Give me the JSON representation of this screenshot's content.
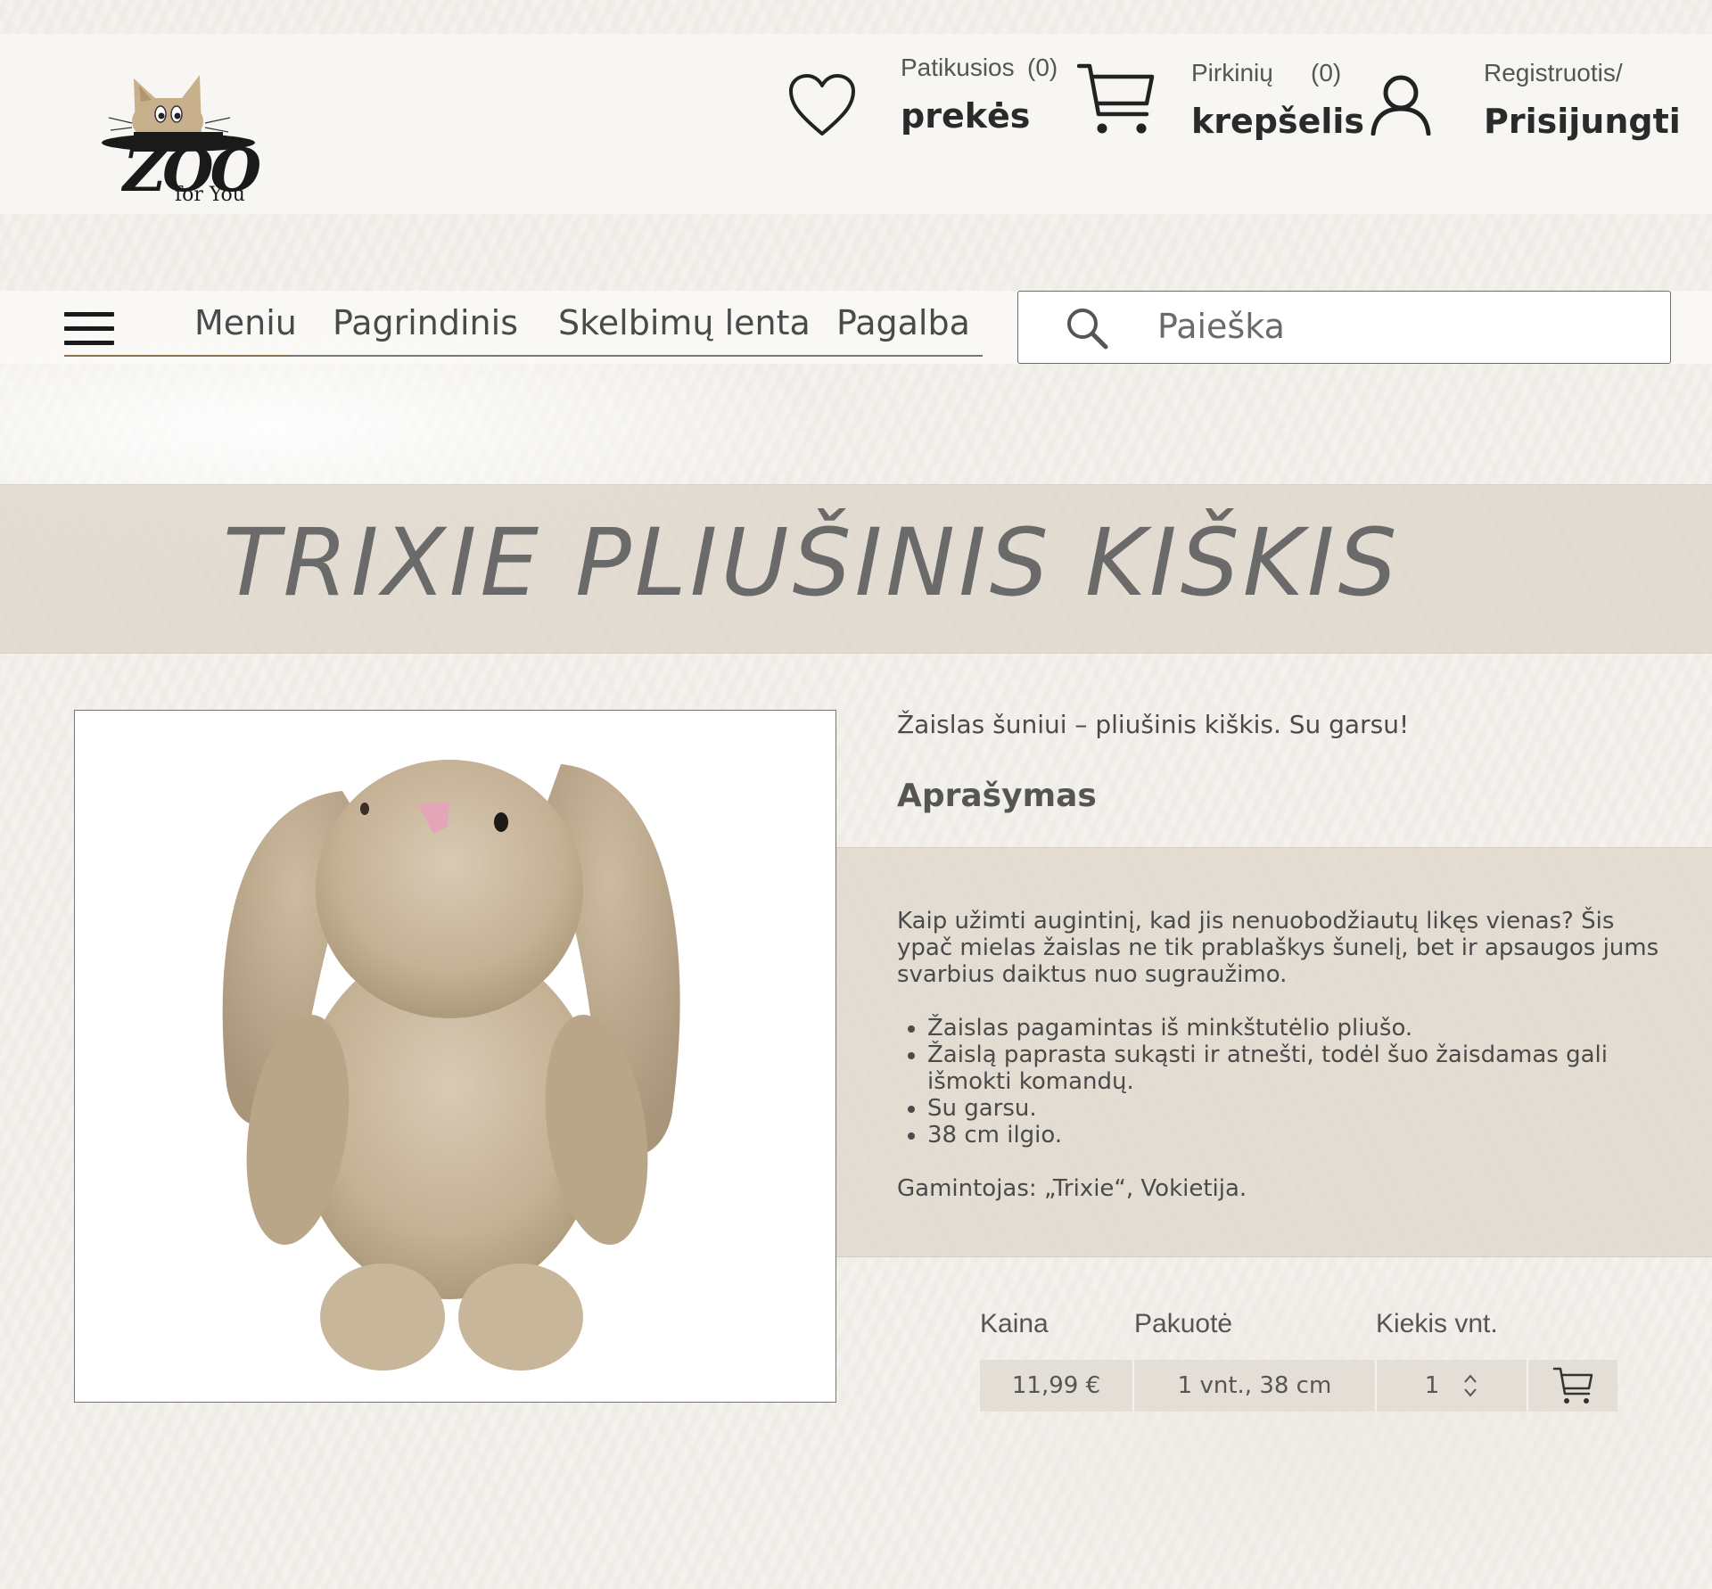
{
  "header": {
    "logo": {
      "alt": "Zoo for You",
      "main": "ZOO",
      "sub": "for You"
    },
    "wishlist": {
      "line1": "Patikusios",
      "count": "(0)",
      "line2": "prekės",
      "icon": "heart-icon"
    },
    "cart": {
      "line1": "Pirkinių",
      "count": "(0)",
      "line2": "krepšelis",
      "icon": "cart-icon"
    },
    "account": {
      "line1": "Registruotis/",
      "line2": "Prisijungti",
      "icon": "user-icon"
    }
  },
  "nav": {
    "menu_icon": "hamburger-icon",
    "items": [
      "Meniu",
      "Pagrindinis",
      "Skelbimų lenta",
      "Pagalba"
    ]
  },
  "search": {
    "placeholder": "Paieška",
    "icon": "search-icon"
  },
  "product": {
    "title": "TRIXIE PLIUŠINIS KIŠKIS",
    "short_description": "Žaislas šuniui – pliušinis kiškis. Su garsu!",
    "description_heading": "Aprašymas",
    "description_intro": "Kaip užimti augintinį, kad jis nenuobodžiautų likęs vienas? Šis ypač mielas žaislas ne tik prablaškys šunelį, bet ir apsaugos jums svarbius daiktus nuo sugraužimo.",
    "features": [
      "Žaislas pagamintas iš minkštutėlio pliušo.",
      "Žaislą paprasta sukąsti ir atnešti, todėl šuo žaisdamas gali išmokti komandų.",
      "Su garsu.",
      "38 cm ilgio."
    ],
    "manufacturer": "Gamintojas: „Trixie“, Vokietija."
  },
  "purchase": {
    "price_label": "Kaina",
    "package_label": "Pakuotė",
    "quantity_label": "Kiekis vnt.",
    "price": "11,99 €",
    "package": "1 vnt., 38 cm",
    "quantity": "1",
    "add_to_cart_icon": "cart-icon"
  },
  "colors": {
    "band": "#dcd4c8",
    "text": "#4a4a4a",
    "nav_underline_active": "#8a7050",
    "logo_cat": "#c8b08c"
  }
}
